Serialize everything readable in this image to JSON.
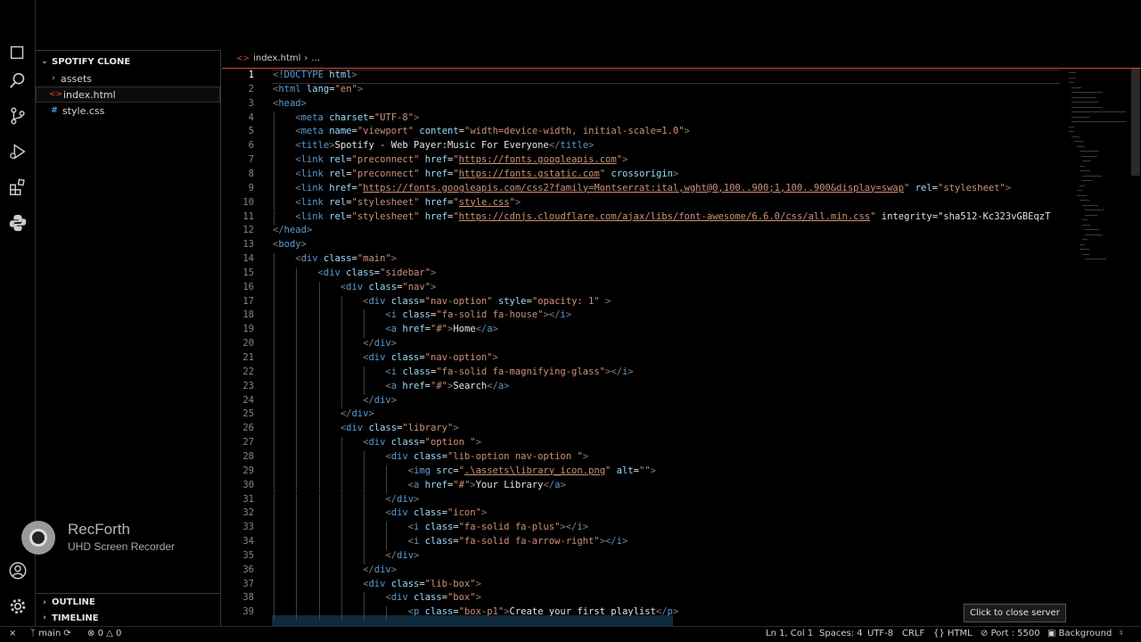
{
  "explorer": {
    "project": "SPOTIFY CLONE",
    "items": [
      {
        "label": "assets",
        "type": "folder"
      },
      {
        "label": "index.html",
        "type": "html"
      },
      {
        "label": "style.css",
        "type": "css"
      }
    ],
    "outline": "OUTLINE",
    "timeline": "TIMELINE"
  },
  "watermark": {
    "title": "RecForth",
    "subtitle": "UHD Screen Recorder"
  },
  "editor": {
    "breadcrumb_file": "index.html",
    "breadcrumb_rest": "...",
    "current_line": 1,
    "lines": [
      {
        "n": 1,
        "i": 0,
        "t": "<!DOCTYPE html>"
      },
      {
        "n": 2,
        "i": 0,
        "t": "<html lang=\"en\">"
      },
      {
        "n": 3,
        "i": 0,
        "t": "<head>"
      },
      {
        "n": 4,
        "i": 1,
        "t": "<meta charset=\"UTF-8\">"
      },
      {
        "n": 5,
        "i": 1,
        "t": "<meta name=\"viewport\" content=\"width=device-width, initial-scale=1.0\">"
      },
      {
        "n": 6,
        "i": 1,
        "t": "<title>Spotify - Web Payer:Music For Everyone</title>"
      },
      {
        "n": 7,
        "i": 1,
        "t": "<link rel=\"preconnect\" href=\"https://fonts.googleapis.com\">"
      },
      {
        "n": 8,
        "i": 1,
        "t": "<link rel=\"preconnect\" href=\"https://fonts.gstatic.com\" crossorigin>"
      },
      {
        "n": 9,
        "i": 1,
        "t": "<link href=\"https://fonts.googleapis.com/css2?family=Montserrat:ital,wght@0,100..900;1,100..900&display=swap\" rel=\"stylesheet\">"
      },
      {
        "n": 10,
        "i": 1,
        "t": "<link rel=\"stylesheet\" href=\"style.css\">"
      },
      {
        "n": 11,
        "i": 1,
        "t": "<link rel=\"stylesheet\" href=\"https://cdnjs.cloudflare.com/ajax/libs/font-awesome/6.6.0/css/all.min.css\" integrity=\"sha512-Kc323vGBEqzT"
      },
      {
        "n": 12,
        "i": 0,
        "t": "</head>"
      },
      {
        "n": 13,
        "i": 0,
        "t": "<body>"
      },
      {
        "n": 14,
        "i": 1,
        "t": "<div class=\"main\">"
      },
      {
        "n": 15,
        "i": 2,
        "t": "<div class=\"sidebar\">"
      },
      {
        "n": 16,
        "i": 3,
        "t": "<div class=\"nav\">"
      },
      {
        "n": 17,
        "i": 4,
        "t": "<div class=\"nav-option\" style=\"opacity: 1\" >"
      },
      {
        "n": 18,
        "i": 5,
        "t": "<i class=\"fa-solid fa-house\"></i>"
      },
      {
        "n": 19,
        "i": 5,
        "t": "<a href=\"#\">Home</a>"
      },
      {
        "n": 20,
        "i": 4,
        "t": "</div>"
      },
      {
        "n": 21,
        "i": 4,
        "t": "<div class=\"nav-option\">"
      },
      {
        "n": 22,
        "i": 5,
        "t": "<i class=\"fa-solid fa-magnifying-glass\"></i>"
      },
      {
        "n": 23,
        "i": 5,
        "t": "<a href=\"#\">Search</a>"
      },
      {
        "n": 24,
        "i": 4,
        "t": "</div>"
      },
      {
        "n": 25,
        "i": 3,
        "t": "</div>"
      },
      {
        "n": 26,
        "i": 3,
        "t": "<div class=\"library\">"
      },
      {
        "n": 27,
        "i": 4,
        "t": "<div class=\"option \">"
      },
      {
        "n": 28,
        "i": 5,
        "t": "<div class=\"lib-option nav-option \">"
      },
      {
        "n": 29,
        "i": 6,
        "t": "<img src=\".\\assets\\library_icon.png\" alt=\"\">"
      },
      {
        "n": 30,
        "i": 6,
        "t": "<a href=\"#\">Your Library</a>"
      },
      {
        "n": 31,
        "i": 5,
        "t": "</div>"
      },
      {
        "n": 32,
        "i": 5,
        "t": "<div class=\"icon\">"
      },
      {
        "n": 33,
        "i": 6,
        "t": "<i class=\"fa-solid fa-plus\"></i>"
      },
      {
        "n": 34,
        "i": 6,
        "t": "<i class=\"fa-solid fa-arrow-right\"></i>"
      },
      {
        "n": 35,
        "i": 5,
        "t": "</div>"
      },
      {
        "n": 36,
        "i": 4,
        "t": "</div>"
      },
      {
        "n": 37,
        "i": 4,
        "t": "<div class=\"lib-box\">"
      },
      {
        "n": 38,
        "i": 5,
        "t": "<div class=\"box\">"
      },
      {
        "n": 39,
        "i": 6,
        "t": "<p class=\"box-p1\">Create your first playlist</p>"
      }
    ]
  },
  "tooltip": "Click to close server",
  "status": {
    "branch": "main",
    "errors": "0",
    "warnings": "0",
    "position": "Ln 1, Col 1",
    "spaces": "Spaces: 4",
    "encoding": "UTF-8",
    "eol": "CRLF",
    "language": "HTML",
    "language_icon": "{}",
    "port": "Port : 5500",
    "background": "Background"
  },
  "colors": {
    "tag": "#569cd6",
    "attr": "#9cdcfe",
    "value": "#ce9178",
    "bracket": "#808080"
  }
}
